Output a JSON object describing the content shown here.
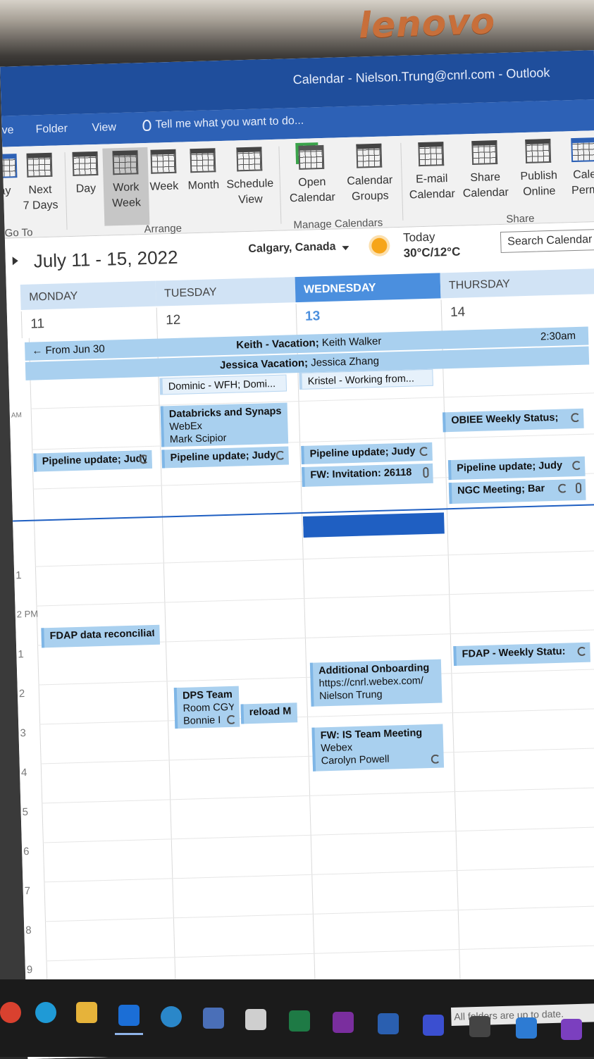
{
  "monitor_brand": "lenovo",
  "window": {
    "title": "Calendar - Nielson.Trung@cnrl.com - Outlook"
  },
  "menu": {
    "items": [
      "ve",
      "Folder",
      "View"
    ],
    "tell_me": "Tell me what you want to do..."
  },
  "ribbon": {
    "buttons": [
      {
        "label": "ay",
        "sub": ""
      },
      {
        "label": "Next",
        "sub": "7 Days"
      },
      {
        "label": "Day",
        "sub": ""
      },
      {
        "label": "Work",
        "sub": "Week"
      },
      {
        "label": "Week",
        "sub": ""
      },
      {
        "label": "Month",
        "sub": ""
      },
      {
        "label": "Schedule",
        "sub": "View"
      },
      {
        "label": "Open",
        "sub": "Calendar"
      },
      {
        "label": "Calendar",
        "sub": "Groups"
      },
      {
        "label": "E-mail",
        "sub": "Calendar"
      },
      {
        "label": "Share",
        "sub": "Calendar"
      },
      {
        "label": "Publish",
        "sub": "Online"
      },
      {
        "label": "Cale",
        "sub": "Perm"
      }
    ],
    "groups": {
      "goto": "Go To",
      "arrange": "Arrange",
      "manage": "Manage Calendars",
      "share": "Share"
    }
  },
  "nav": {
    "date_range": "July 11 - 15, 2022",
    "location": "Calgary, Canada",
    "weather": {
      "today_label": "Today",
      "temp": "30°C/12°C"
    },
    "search_placeholder": "Search Calendar"
  },
  "days": [
    {
      "name": "MONDAY",
      "num": "11"
    },
    {
      "name": "TUESDAY",
      "num": "12"
    },
    {
      "name": "WEDNESDAY",
      "num": "13"
    },
    {
      "name": "THURSDAY",
      "num": "14"
    }
  ],
  "hours": [
    "AM",
    "",
    "1",
    "2 PM",
    "1",
    "2",
    "3",
    "4",
    "5",
    "6",
    "7",
    "8",
    "9"
  ],
  "all_day": {
    "keith_left": "From Jun 30",
    "keith_title": "Keith - Vacation;",
    "keith_sub": "Keith Walker",
    "keith_right": "2:30am",
    "jessica_title": "Jessica Vacation;",
    "jessica_sub": "Jessica Zhang",
    "dominic": "Dominic - WFH; Domi...",
    "kristel": "Kristel - Working from..."
  },
  "events": {
    "databricks": {
      "title": "Databricks and Synapse",
      "l1": "WebEx",
      "l2": "Mark Scipior"
    },
    "pipeline_mon": "Pipeline update; Judy",
    "pipeline_tue": "Pipeline update; Judy",
    "pipeline_wed": "Pipeline update; Judy",
    "pipeline_thu": "Pipeline update; Judy",
    "obiee": "OBIEE Weekly Status;",
    "fw_invite": "FW: Invitation: 26118",
    "ngc": "NGC Meeting; Bar",
    "fdap_recon": "FDAP data reconciliatio",
    "fdap_weekly": "FDAP - Weekly Statu:",
    "dps": {
      "title": "DPS Team",
      "l1": "Room CGY-",
      "l2": "Bonnie I"
    },
    "reload": "reload Ma",
    "onboarding": {
      "title": "Additional Onboarding",
      "l1": "https://cnrl.webex.com/",
      "l2": "Nielson Trung"
    },
    "is_team": {
      "title": "FW: IS Team Meeting",
      "l1": "Webex",
      "l2": "Carolyn Powell"
    }
  },
  "status_bar": "All folders are up to date."
}
